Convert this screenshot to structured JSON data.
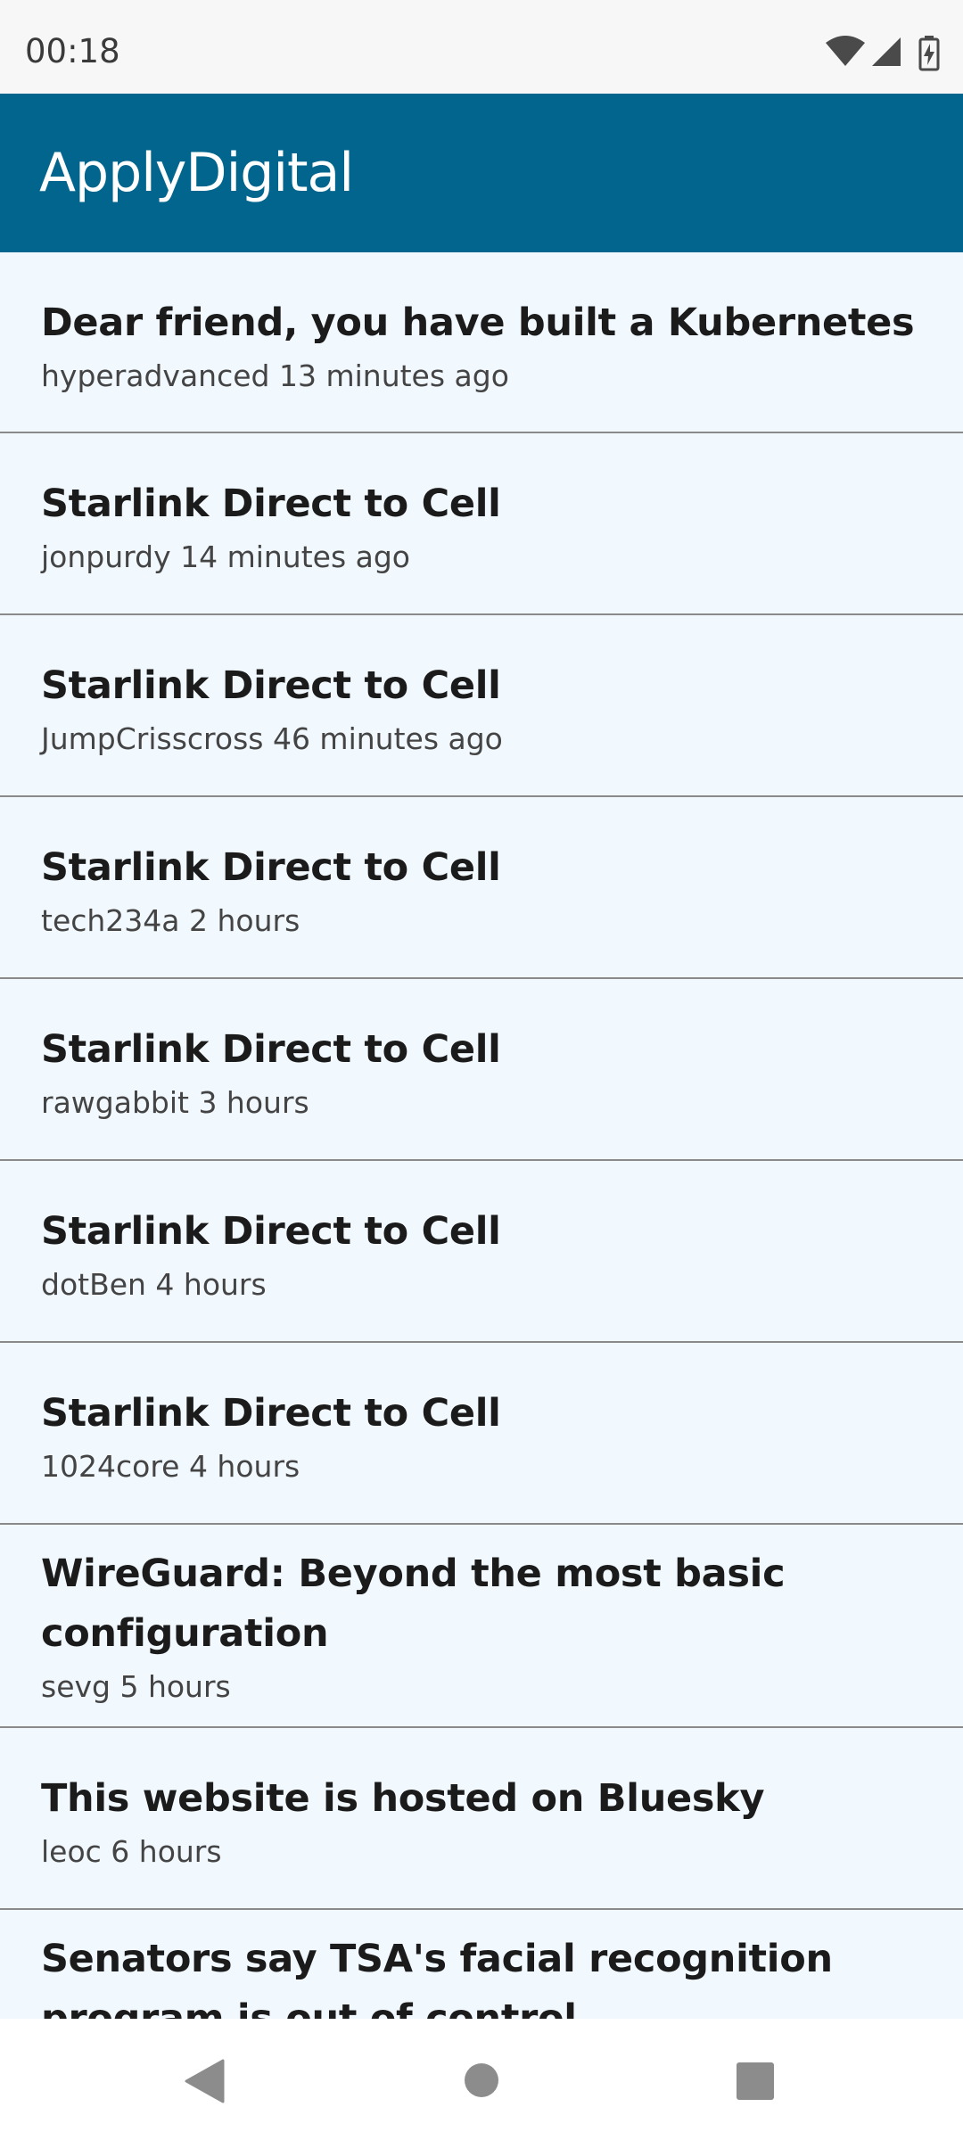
{
  "status_bar": {
    "time": "00:18",
    "icons": [
      "wifi-icon",
      "cell-signal-icon",
      "battery-charging-icon"
    ]
  },
  "app_bar": {
    "title": "ApplyDigital",
    "background_color": "#02658e"
  },
  "stories": [
    {
      "title": "Dear friend, you have built a Kubernetes",
      "meta": "hyperadvanced 13 minutes ago"
    },
    {
      "title": "Starlink Direct to Cell",
      "meta": "jonpurdy 14 minutes ago"
    },
    {
      "title": "Starlink Direct to Cell",
      "meta": "JumpCrisscross 46 minutes ago"
    },
    {
      "title": "Starlink Direct to Cell",
      "meta": "tech234a 2 hours"
    },
    {
      "title": "Starlink Direct to Cell",
      "meta": "rawgabbit 3 hours"
    },
    {
      "title": "Starlink Direct to Cell",
      "meta": "dotBen 4 hours"
    },
    {
      "title": "Starlink Direct to Cell",
      "meta": "1024core 4 hours"
    },
    {
      "title": "WireGuard: Beyond the most basic configuration",
      "meta": "sevg 5 hours"
    },
    {
      "title": "This website is hosted on Bluesky",
      "meta": "leoc 6 hours"
    },
    {
      "title": "Senators say TSA's facial recognition program is out of control",
      "meta": ""
    }
  ],
  "nav_bar": {
    "buttons": [
      "back-icon",
      "home-icon",
      "recents-icon"
    ]
  },
  "colors": {
    "list_background": "#f1f8fe",
    "divider": "#8a8a8a",
    "title_text": "#1b1b1b",
    "meta_text": "#444444"
  }
}
